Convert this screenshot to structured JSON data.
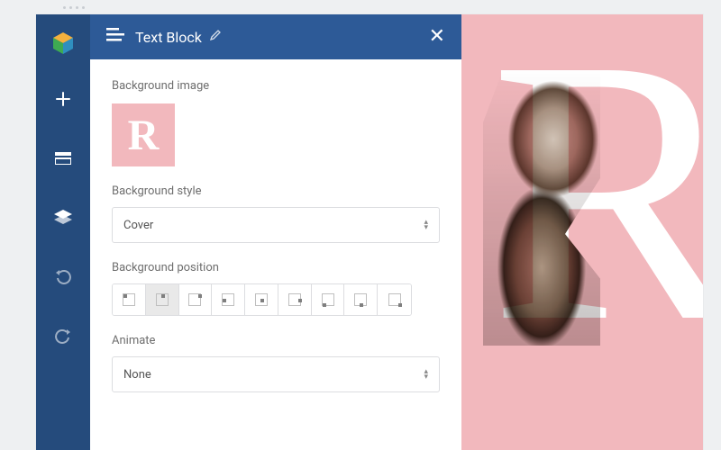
{
  "sidebar": {
    "buttons": [
      {
        "name": "add",
        "title": "Add element"
      },
      {
        "name": "row",
        "title": "Row layout"
      },
      {
        "name": "layers",
        "title": "Layers"
      },
      {
        "name": "undo",
        "title": "Undo"
      },
      {
        "name": "redo",
        "title": "Redo"
      }
    ]
  },
  "panel": {
    "title": "Text Block",
    "fields": {
      "bg_image": {
        "label": "Background image",
        "thumb_glyph": "R"
      },
      "bg_style": {
        "label": "Background style",
        "value": "Cover"
      },
      "bg_position": {
        "label": "Background position",
        "options": [
          "left-top",
          "center-top",
          "right-top",
          "left-center",
          "center-center",
          "right-center",
          "left-bottom",
          "center-bottom",
          "right-bottom"
        ],
        "selected": "center-top"
      },
      "animate": {
        "label": "Animate",
        "value": "None"
      }
    }
  },
  "preview": {
    "glyph": "R"
  }
}
